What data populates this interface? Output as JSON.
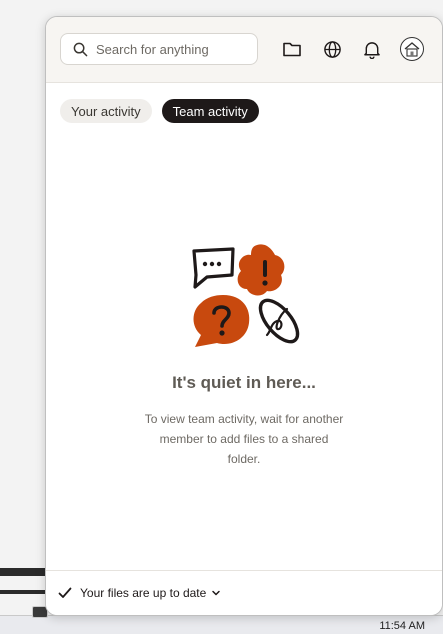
{
  "search": {
    "placeholder": "Search for anything"
  },
  "header": {
    "icons": [
      "search-icon",
      "folder-icon",
      "globe-icon",
      "bell-icon",
      "avatar"
    ]
  },
  "tabs": [
    {
      "label": "Your activity",
      "active": false
    },
    {
      "label": "Team activity",
      "active": true
    }
  ],
  "empty_state": {
    "title": "It's quiet in here...",
    "body": "To view team activity, wait for another member to add files to a shared folder."
  },
  "footer": {
    "status": "Your files are up to date"
  },
  "taskbar": {
    "time": "11:54 AM"
  },
  "colors": {
    "accent_orange": "#c8490e",
    "dark": "#1e1919",
    "header_bg": "#f7f5f2"
  }
}
